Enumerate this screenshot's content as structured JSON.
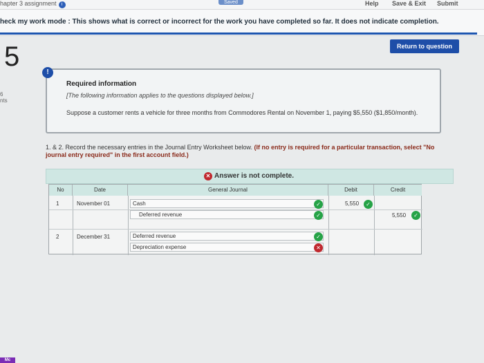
{
  "topbar": {
    "chapter": "hapter 3 assignment",
    "saved": "Saved",
    "help": "Help",
    "save_exit": "Save & Exit",
    "submit": "Submit"
  },
  "mode_bar": {
    "text": "heck my work mode : This shows what is correct or incorrect for the work you have completed so far. It does not indicate completion."
  },
  "question": {
    "number": "5",
    "points_line1": "6",
    "points_line2": "nts",
    "return_label": "Return to question"
  },
  "info": {
    "heading": "Required information",
    "subheading": "[The following information applies to the questions displayed below.]",
    "body": "Suppose a customer rents a vehicle for three months from Commodores Rental on November 1, paying $5,550 ($1,850/month)."
  },
  "instruction": {
    "text": "1. & 2. Record the necessary entries in the Journal Entry Worksheet below.",
    "bold": "(If no entry is required for a particular transaction, select \"No journal entry required\" in the first account field.)"
  },
  "answer_status": "Answer is not complete.",
  "journal": {
    "headers": {
      "no": "No",
      "date": "Date",
      "general_journal": "General Journal",
      "debit": "Debit",
      "credit": "Credit"
    },
    "rows": [
      {
        "no": "1",
        "date": "November 01",
        "account": "Cash",
        "debit": "5,550",
        "credit": "",
        "status": "correct"
      },
      {
        "no": "",
        "date": "",
        "account": "Deferred revenue",
        "debit": "",
        "credit": "5,550",
        "status": "correct"
      },
      {
        "no": "2",
        "date": "December 31",
        "account": "Deferred revenue",
        "debit": "",
        "credit": "",
        "status": "correct"
      },
      {
        "no": "",
        "date": "",
        "account": "Depreciation expense",
        "debit": "",
        "credit": "",
        "status": "incorrect"
      }
    ]
  },
  "logo_text": "Mc"
}
